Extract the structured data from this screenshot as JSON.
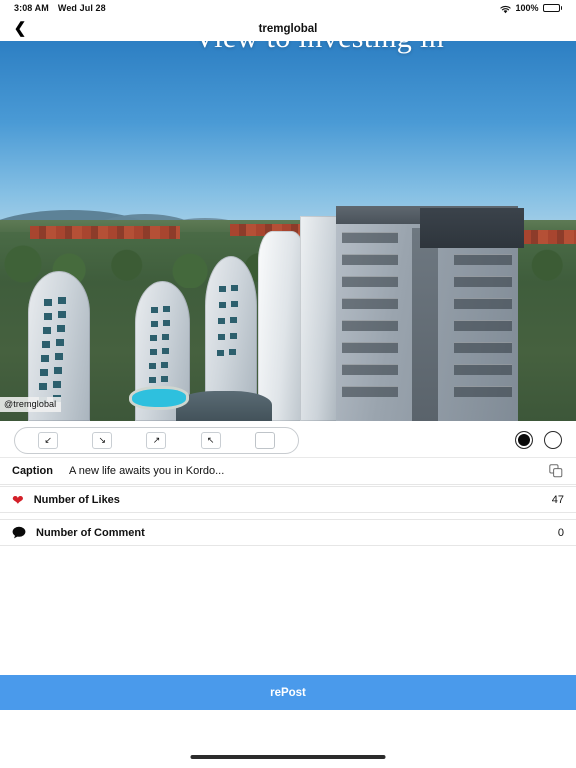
{
  "status_bar": {
    "time": "3:08 AM",
    "date": "Wed Jul 28",
    "wifi_icon": "wifi-icon",
    "battery_percent": "100%",
    "battery_icon": "battery-full-icon"
  },
  "nav": {
    "back_icon": "chevron-left-icon",
    "title": "tremglobal"
  },
  "media": {
    "overlay_title": "View to investing in",
    "watermark": "@tremglobal",
    "image_description": "Aerial view of seaside residential towers overlooking blue sea and islands"
  },
  "toolbar": {
    "crop_buttons": [
      {
        "name": "crop-bottom-left",
        "glyph": "↙"
      },
      {
        "name": "crop-bottom-right",
        "glyph": "↘"
      },
      {
        "name": "crop-top-right",
        "glyph": "↗"
      },
      {
        "name": "crop-top-left",
        "glyph": "↖"
      },
      {
        "name": "crop-square",
        "glyph": ""
      }
    ],
    "ratio_dots": [
      {
        "name": "ratio-option-filled",
        "selected": true
      },
      {
        "name": "ratio-option-empty",
        "selected": false
      }
    ]
  },
  "details": {
    "caption_label": "Caption",
    "caption_text": "A new life awaits you in Kordo...",
    "copy_icon": "copy-icon",
    "likes_icon": "heart-icon",
    "likes_label": "Number of Likes",
    "likes_value": "47",
    "comments_icon": "comment-bubble-icon",
    "comments_label": "Number of Comment",
    "comments_value": "0"
  },
  "footer": {
    "repost_label": "rePost"
  },
  "colors": {
    "accent_blue": "#4a9aeb",
    "heart_red": "#d32029",
    "sea_blue": "#1c6bad"
  }
}
